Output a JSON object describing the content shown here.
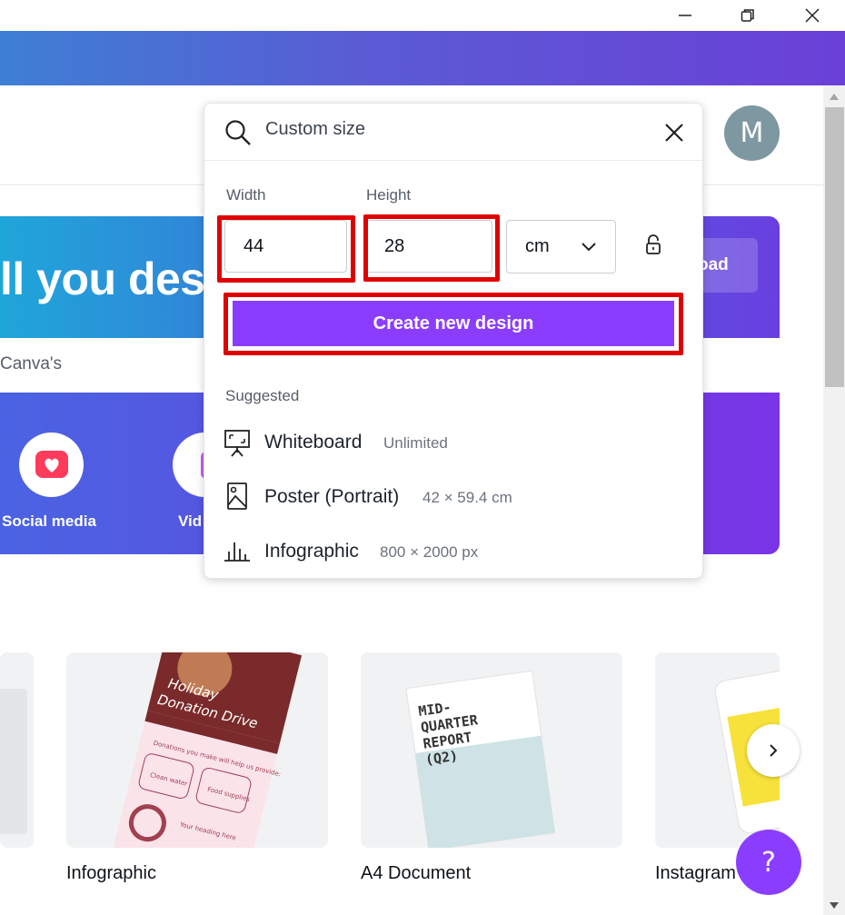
{
  "hero": {
    "title": "ll you des",
    "subtitle": "Canva's",
    "upload_label": "oad"
  },
  "categories": [
    {
      "label": "Social media",
      "icon": "heart-icon"
    },
    {
      "label": "Vid",
      "icon": "video-icon"
    }
  ],
  "avatar": {
    "initial": "M"
  },
  "search": {
    "value": "Custom size",
    "placeholder": "Custom size"
  },
  "custom_size": {
    "width_label": "Width",
    "height_label": "Height",
    "width_value": "44",
    "height_value": "28",
    "unit": "cm",
    "create_label": "Create new design"
  },
  "suggested": {
    "heading": "Suggested",
    "items": [
      {
        "name": "Whiteboard",
        "meta": "Unlimited",
        "icon": "whiteboard-icon"
      },
      {
        "name": "Poster (Portrait)",
        "meta": "42 × 59.4 cm",
        "icon": "poster-icon"
      },
      {
        "name": "Infographic",
        "meta": "800 × 2000 px",
        "icon": "infographic-icon"
      }
    ]
  },
  "cards": [
    {
      "label": "Infographic",
      "thumb_text": "Holiday Donation Drive"
    },
    {
      "label": "A4 Document",
      "thumb_text": "MID-QUARTER REPORT (Q2)"
    },
    {
      "label": "Instagram"
    }
  ],
  "help": {
    "label": "?"
  },
  "colors": {
    "brand_purple": "#8b3dff",
    "highlight_red": "#e00000"
  }
}
